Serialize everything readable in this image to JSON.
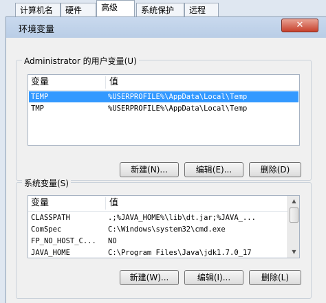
{
  "tabs": [
    {
      "label": "计算机名"
    },
    {
      "label": "硬件"
    },
    {
      "label": "高级"
    },
    {
      "label": "系统保护"
    },
    {
      "label": "远程"
    }
  ],
  "dialog": {
    "title": "环境变量",
    "close_glyph": "✕"
  },
  "user_vars": {
    "group_label": "Administrator 的用户变量(U)",
    "col_var": "变量",
    "col_val": "值",
    "rows": [
      {
        "name": "TEMP",
        "value": "%USERPROFILE%\\AppData\\Local\\Temp"
      },
      {
        "name": "TMP",
        "value": "%USERPROFILE%\\AppData\\Local\\Temp"
      }
    ],
    "buttons": {
      "new": "新建(N)...",
      "edit": "编辑(E)...",
      "delete": "删除(D)"
    }
  },
  "sys_vars": {
    "group_label": "系统变量(S)",
    "col_var": "变量",
    "col_val": "值",
    "rows": [
      {
        "name": "CLASSPATH",
        "value": ".;%JAVA_HOME%\\lib\\dt.jar;%JAVA_..."
      },
      {
        "name": "ComSpec",
        "value": "C:\\Windows\\system32\\cmd.exe"
      },
      {
        "name": "FP_NO_HOST_C...",
        "value": "NO"
      },
      {
        "name": "JAVA_HOME",
        "value": "C:\\Program Files\\Java\\jdk1.7.0_17"
      }
    ],
    "buttons": {
      "new": "新建(W)...",
      "edit": "编辑(I)...",
      "delete": "删除(L)"
    }
  }
}
